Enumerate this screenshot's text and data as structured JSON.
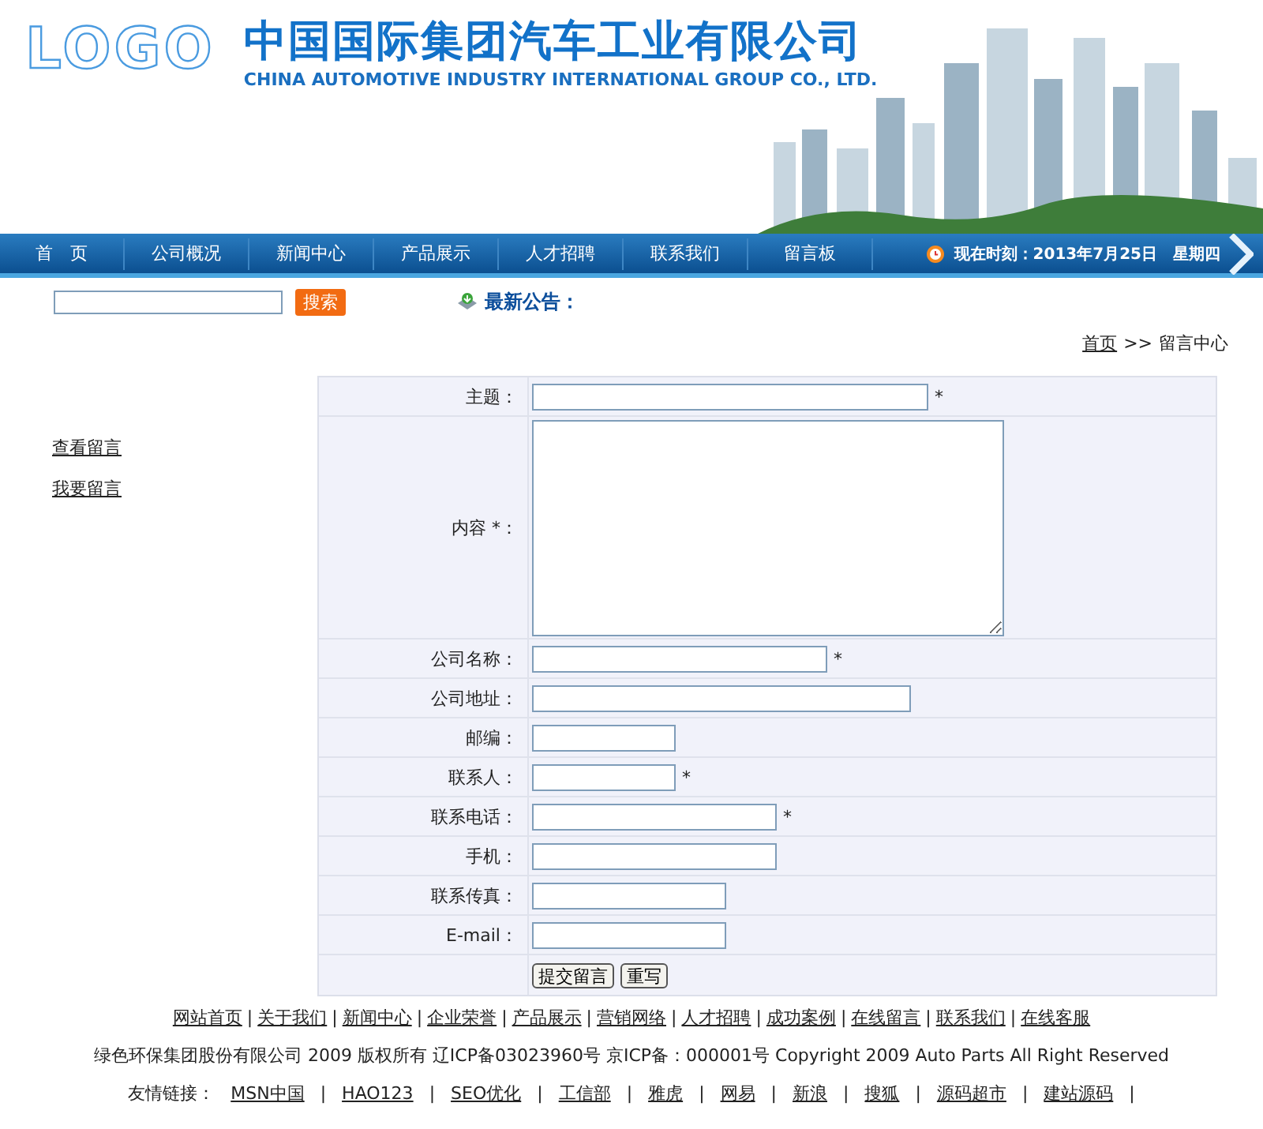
{
  "header": {
    "logo": "LOGO",
    "company_name": "中国国际集团汽车工业有限公司",
    "company_name_en": "CHINA AUTOMOTIVE INDUSTRY INTERNATIONAL GROUP CO., LTD."
  },
  "nav": {
    "items": [
      {
        "label": "首　页"
      },
      {
        "label": "公司概况"
      },
      {
        "label": "新闻中心"
      },
      {
        "label": "产品展示"
      },
      {
        "label": "人才招聘"
      },
      {
        "label": "联系我们"
      },
      {
        "label": "留言板"
      }
    ],
    "time": "现在时刻：2013年7月25日　星期四"
  },
  "search": {
    "button": "搜索"
  },
  "notice": {
    "title": "最新公告："
  },
  "breadcrumb": {
    "home": "首页",
    "separator": ">>",
    "current": "留言中心"
  },
  "sidebar": {
    "items": [
      {
        "label": "查看留言"
      },
      {
        "label": "我要留言"
      }
    ]
  },
  "form": {
    "fields": [
      {
        "label": "主题：",
        "kind": "input",
        "required": true
      },
      {
        "label": "内容 *：",
        "kind": "textarea",
        "required": false
      },
      {
        "label": "公司名称：",
        "kind": "input",
        "required": true
      },
      {
        "label": "公司地址：",
        "kind": "input",
        "required": false
      },
      {
        "label": "邮编：",
        "kind": "input",
        "required": false
      },
      {
        "label": "联系人：",
        "kind": "input",
        "required": true
      },
      {
        "label": "联系电话：",
        "kind": "input",
        "required": true
      },
      {
        "label": "手机：",
        "kind": "input",
        "required": false
      },
      {
        "label": "联系传真：",
        "kind": "input",
        "required": false
      },
      {
        "label": "E-mail：",
        "kind": "input",
        "required": false
      }
    ],
    "required_mark": "*",
    "buttons": [
      {
        "label": "提交留言"
      },
      {
        "label": "重写"
      }
    ]
  },
  "footer": {
    "links": [
      {
        "label": "网站首页"
      },
      {
        "label": "关于我们"
      },
      {
        "label": "新闻中心"
      },
      {
        "label": "企业荣誉"
      },
      {
        "label": "产品展示"
      },
      {
        "label": "营销网络"
      },
      {
        "label": "人才招聘"
      },
      {
        "label": "成功案例"
      },
      {
        "label": "在线留言"
      },
      {
        "label": "联系我们"
      },
      {
        "label": "在线客服"
      }
    ],
    "separator": "|",
    "copyright": "绿色环保集团股份有限公司 2009 版权所有 辽ICP备03023960号 京ICP备：000001号 Copyright 2009 Auto Parts All Right Reserved",
    "friend_label": "友情链接：",
    "friend_links": [
      {
        "label": "MSN中国"
      },
      {
        "label": "HAO123"
      },
      {
        "label": "SEO优化"
      },
      {
        "label": "工信部"
      },
      {
        "label": "雅虎"
      },
      {
        "label": "网易"
      },
      {
        "label": "新浪"
      },
      {
        "label": "搜狐"
      },
      {
        "label": "源码超市"
      },
      {
        "label": "建站源码"
      }
    ]
  }
}
